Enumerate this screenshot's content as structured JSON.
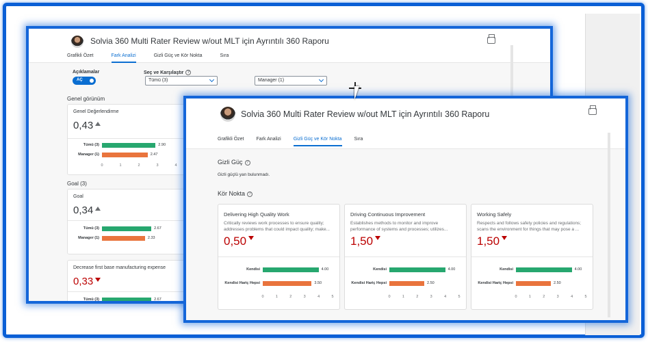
{
  "back_window": {
    "title": "Solvia 360 Multi Rater Review w/out MLT için Ayrıntılı 360 Raporu",
    "tabs": [
      "Grafikli Özet",
      "Fark Analizi",
      "Gizli Güç ve Kör Nokta",
      "Sıra"
    ],
    "active_tab": 1,
    "aciklamalar_label": "Açıklamalar",
    "toggle_label": "AÇ",
    "sec_label": "Seç ve Karşılaştır",
    "select1_value": "Tümü (3)",
    "select2_value": "Manager (1)",
    "section1": "Genel görünüm",
    "card1": {
      "name": "Genel Değerlendirme",
      "value": "0,43",
      "rows": [
        {
          "label": "Tümü (3)",
          "value": 2.9,
          "value_label": "2.90",
          "color": "green"
        },
        {
          "label": "Manager (1)",
          "value": 2.47,
          "value_label": "2.47",
          "color": "orange"
        }
      ],
      "axis": [
        "0",
        "1",
        "2",
        "3",
        "4"
      ]
    },
    "section2": "Goal (3)",
    "card2": {
      "name": "Goal",
      "value": "0,34",
      "rows": [
        {
          "label": "Tümü (3)",
          "value": 2.67,
          "value_label": "2.67",
          "color": "green"
        },
        {
          "label": "Manager (1)",
          "value": 2.33,
          "value_label": "2.33",
          "color": "orange"
        }
      ],
      "axis": [
        "0",
        "1",
        "2",
        "3",
        "4"
      ]
    },
    "card3": {
      "name": "Decrease first base manufacturing expense",
      "value": "0,33",
      "rows": [
        {
          "label": "Tümü (3)",
          "value": 2.67,
          "value_label": "2.67",
          "color": "green"
        }
      ]
    }
  },
  "front_window": {
    "title": "Solvia 360 Multi Rater Review w/out MLT için Ayrıntılı 360 Raporu",
    "tabs": [
      "Grafikli Özet",
      "Fark Analizi",
      "Gizli Güç ve Kör Nokta",
      "Sıra"
    ],
    "active_tab": 2,
    "gizli_guc_heading": "Gizli Güç",
    "gizli_guc_text": "Gizli güçlü yan bulunmadı.",
    "kor_nokta_heading": "Kör Nokta",
    "cards": [
      {
        "title": "Delivering High Quality Work",
        "desc1": "Critically reviews work processes to ensure quality;",
        "desc2": "addresses problems that could impact quality; make...",
        "value": "0,50",
        "rows": [
          {
            "label": "Kendisi",
            "value": 4.0,
            "value_label": "4.00",
            "color": "green"
          },
          {
            "label": "Kendisi Hariç Hepsi",
            "value": 3.5,
            "value_label": "3.50",
            "color": "orange"
          }
        ],
        "axis": [
          "0",
          "1",
          "2",
          "3",
          "4",
          "5"
        ]
      },
      {
        "title": "Driving Continuous Improvement",
        "desc1": "Establishes methods to monitor and improve",
        "desc2": "performance of systems and processes; utilizes...",
        "value": "1,50",
        "rows": [
          {
            "label": "Kendisi",
            "value": 4.0,
            "value_label": "4.00",
            "color": "green"
          },
          {
            "label": "Kendisi Hariç Hepsi",
            "value": 2.5,
            "value_label": "2.50",
            "color": "orange"
          }
        ],
        "axis": [
          "0",
          "1",
          "2",
          "3",
          "4",
          "5"
        ]
      },
      {
        "title": "Working Safely",
        "desc1": "Respects and follows safety policies and regulations;",
        "desc2": "scans the environment for things that may pose a ...",
        "value": "1,50",
        "rows": [
          {
            "label": "Kendisi",
            "value": 4.0,
            "value_label": "4.00",
            "color": "green"
          },
          {
            "label": "Kendisi Hariç Hepsi",
            "value": 2.5,
            "value_label": "2.50",
            "color": "orange"
          }
        ],
        "axis": [
          "0",
          "1",
          "2",
          "3",
          "4",
          "5"
        ]
      }
    ]
  }
}
